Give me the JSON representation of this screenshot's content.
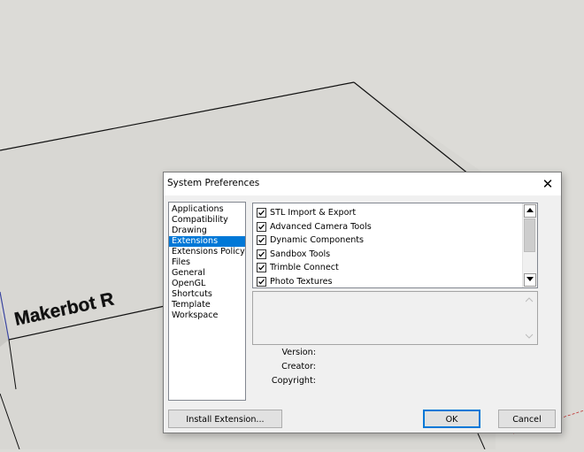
{
  "viewport": {
    "model_label": "Makerbot R"
  },
  "dialog": {
    "title": "System Preferences",
    "close_glyph": "✕",
    "categories": [
      {
        "label": "Applications",
        "selected": false
      },
      {
        "label": "Compatibility",
        "selected": false
      },
      {
        "label": "Drawing",
        "selected": false
      },
      {
        "label": "Extensions",
        "selected": true
      },
      {
        "label": "Extensions Policy",
        "selected": false
      },
      {
        "label": "Files",
        "selected": false
      },
      {
        "label": "General",
        "selected": false
      },
      {
        "label": "OpenGL",
        "selected": false
      },
      {
        "label": "Shortcuts",
        "selected": false
      },
      {
        "label": "Template",
        "selected": false
      },
      {
        "label": "Workspace",
        "selected": false
      }
    ],
    "extensions": [
      {
        "label": "STL Import & Export",
        "checked": true
      },
      {
        "label": "Advanced Camera Tools",
        "checked": true
      },
      {
        "label": "Dynamic Components",
        "checked": true
      },
      {
        "label": "Sandbox Tools",
        "checked": true
      },
      {
        "label": "Trimble Connect",
        "checked": true
      },
      {
        "label": "Photo Textures",
        "checked": true
      }
    ],
    "meta": {
      "version_label": "Version:",
      "creator_label": "Creator:",
      "copyright_label": "Copyright:"
    },
    "buttons": {
      "install": "Install Extension...",
      "ok": "OK",
      "cancel": "Cancel"
    },
    "icons": {
      "close": "close-icon",
      "check": "checkmark-icon",
      "up": "arrow-up-icon",
      "down": "arrow-down-icon"
    },
    "colors": {
      "selection": "#0078d7",
      "dialog_bg": "#f0f0f0",
      "viewport_bg": "#dcdbd7"
    }
  }
}
